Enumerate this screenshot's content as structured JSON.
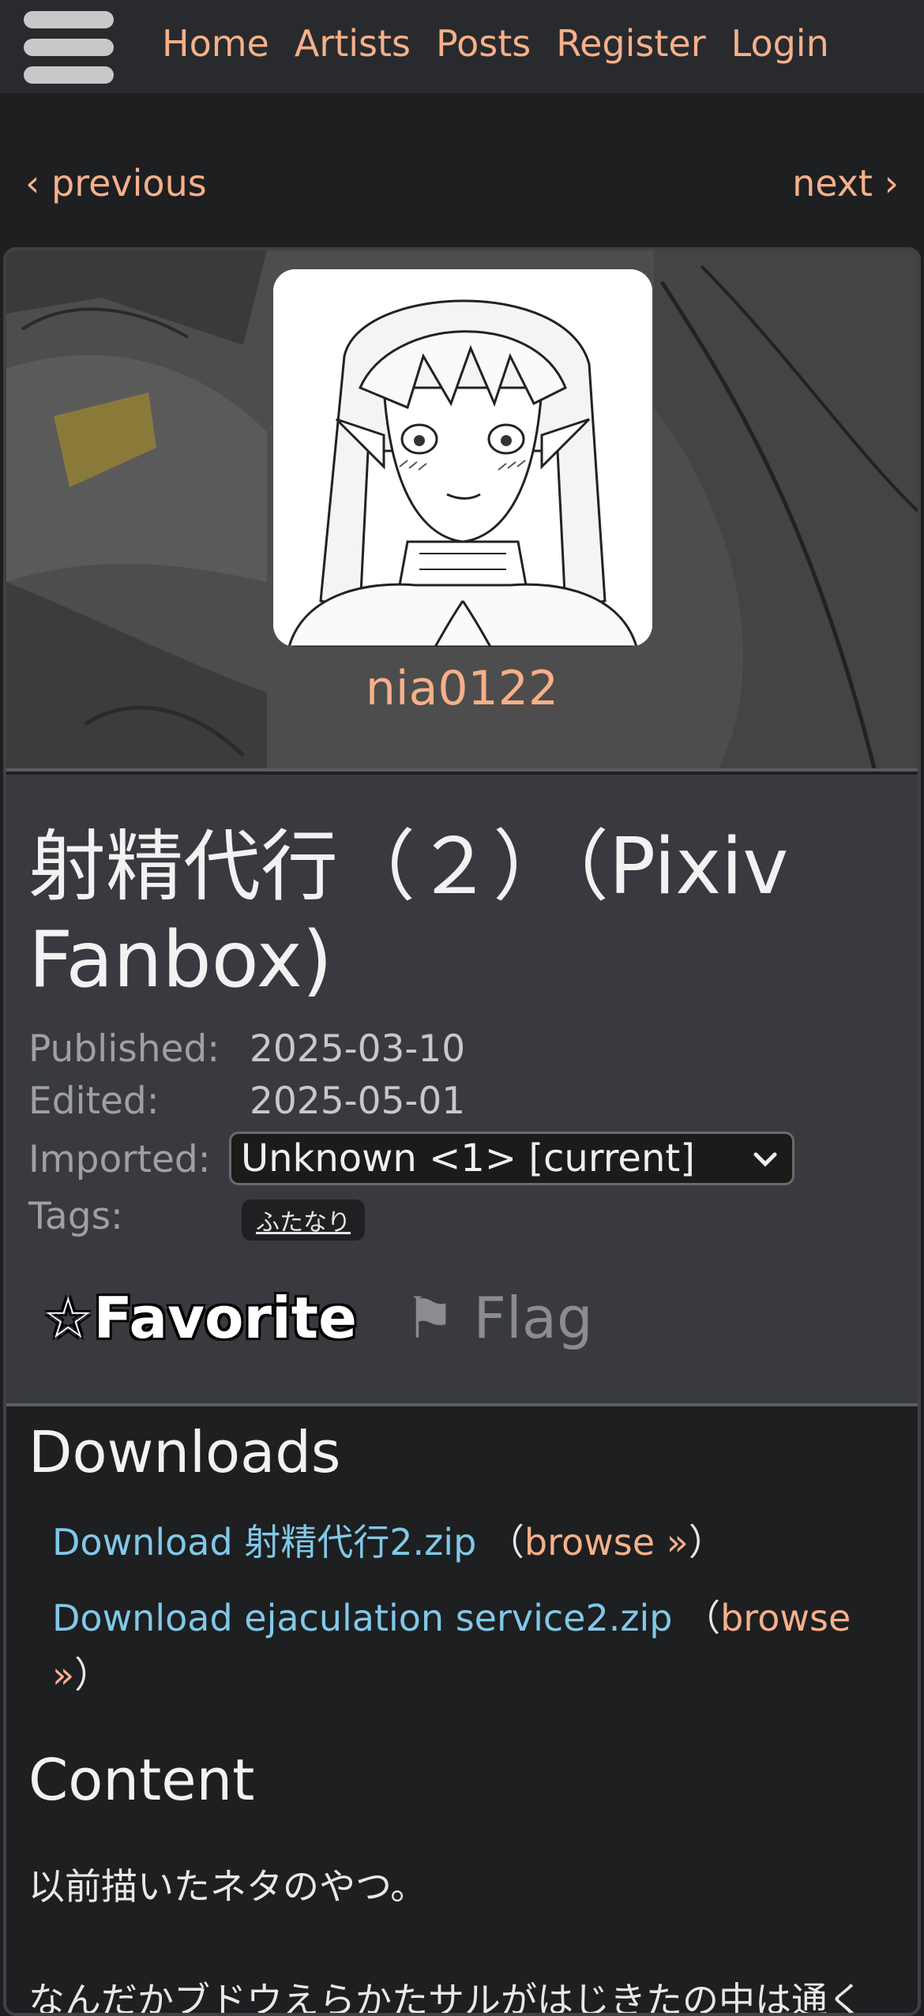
{
  "nav": {
    "links": [
      "Home",
      "Artists",
      "Posts",
      "Register",
      "Login"
    ]
  },
  "pager": {
    "previous": "‹ previous",
    "next": "next ›"
  },
  "artist": {
    "name": "nia0122"
  },
  "post": {
    "title": "射精代行（２）（Pixiv Fanbox)",
    "published_label": "Published:",
    "published_value": "2025-03-10",
    "edited_label": "Edited:",
    "edited_value": "2025-05-01",
    "imported_label": "Imported:",
    "imported_value": "Unknown <1> [current]",
    "tags_label": "Tags:",
    "tags": [
      "ふたなり"
    ],
    "favorite_star": "☆",
    "favorite_label": "Favorite",
    "flag_icon": "⚑",
    "flag_label": "Flag"
  },
  "downloads": {
    "heading": "Downloads",
    "items": [
      {
        "link": "Download 射精代行2.zip",
        "browse": "browse »"
      },
      {
        "link": "Download ejaculation service2.zip",
        "browse": "browse »"
      }
    ]
  },
  "content": {
    "heading": "Content",
    "lines": [
      "以前描いたネタのやつ。",
      "なんだかブドウえらかたサルがはじきたの中は通く"
    ]
  },
  "colors": {
    "accent": "#f5b08a",
    "link": "#81c8e8",
    "navbar": "#282a2e",
    "background": "#1d1f21",
    "info_panel": "#383a40"
  }
}
